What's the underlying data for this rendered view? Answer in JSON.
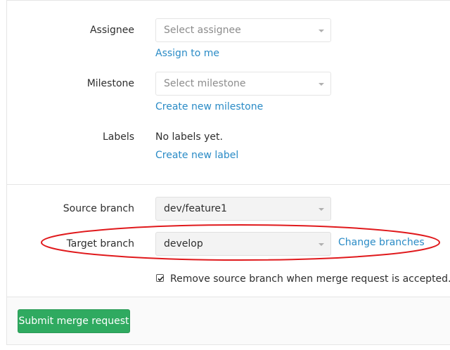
{
  "form": {
    "assignee": {
      "label": "Assignee",
      "placeholder": "Select assignee",
      "link": "Assign to me"
    },
    "milestone": {
      "label": "Milestone",
      "placeholder": "Select milestone",
      "link": "Create new milestone"
    },
    "labels": {
      "label": "Labels",
      "value": "No labels yet.",
      "link": "Create new label"
    },
    "source_branch": {
      "label": "Source branch",
      "value": "dev/feature1"
    },
    "target_branch": {
      "label": "Target branch",
      "value": "develop",
      "link": "Change branches"
    },
    "remove_source": {
      "label": "Remove source branch when merge request is accepted.",
      "checked": true
    },
    "submit": {
      "label": "Submit merge request"
    }
  },
  "colors": {
    "link": "#2a8bc6",
    "submit_button": "#2faa60",
    "annotation_ellipse": "#e0191c"
  }
}
